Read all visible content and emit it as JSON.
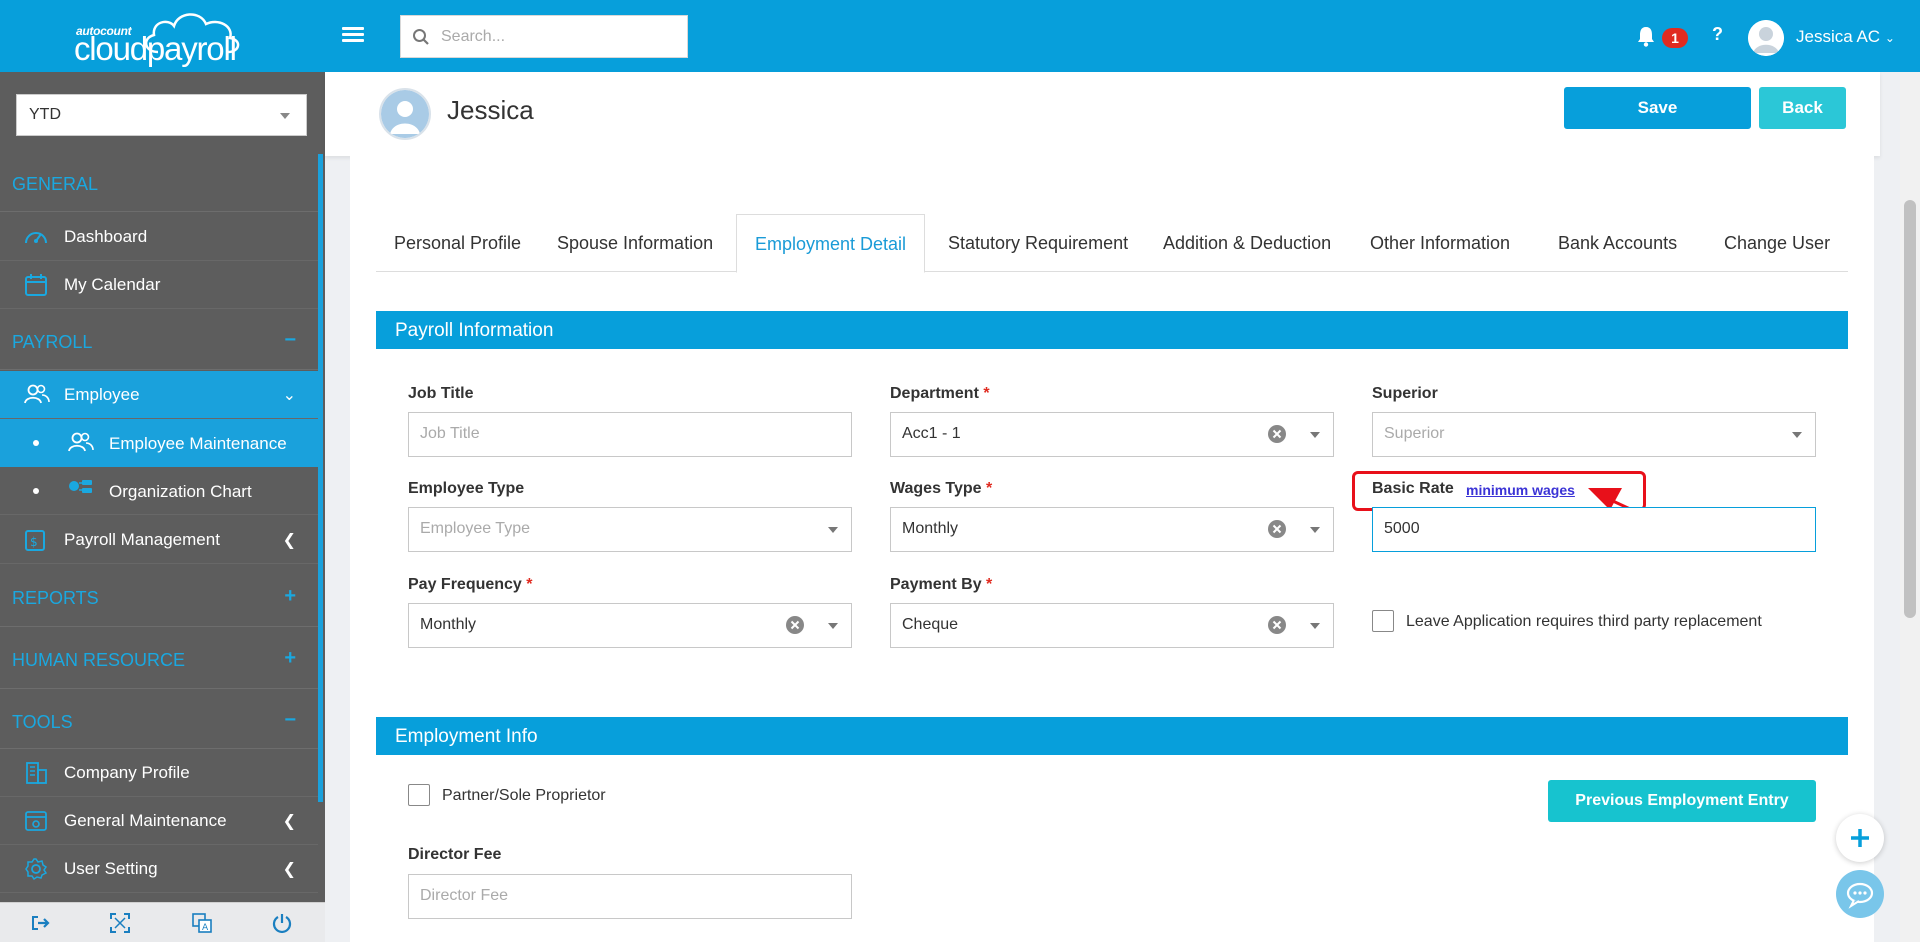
{
  "app": {
    "logo_small": "autocount",
    "logo_big": "cloudpayroll",
    "search_placeholder": "Search...",
    "notification_count": "1",
    "help": "?",
    "user": "Jessica AC"
  },
  "sidebar": {
    "period": "YTD",
    "sections": {
      "general": "GENERAL",
      "payroll": "PAYROLL",
      "reports": "REPORTS",
      "human_resource": "HUMAN RESOURCE",
      "tools": "TOOLS"
    },
    "signs": {
      "payroll": "−",
      "reports": "+",
      "human_resource": "+",
      "tools": "−"
    },
    "items": {
      "dashboard": "Dashboard",
      "my_calendar": "My Calendar",
      "employee": "Employee",
      "employee_maintenance": "Employee Maintenance",
      "organization_chart": "Organization Chart",
      "payroll_management": "Payroll Management",
      "company_profile": "Company Profile",
      "general_maintenance": "General Maintenance",
      "user_setting": "User Setting"
    }
  },
  "header": {
    "employee_name": "Jessica",
    "save": "Save",
    "back": "Back"
  },
  "tabs": [
    "Personal Profile",
    "Spouse Information",
    "Employment Detail",
    "Statutory Requirement",
    "Addition & Deduction",
    "Other Information",
    "Bank Accounts",
    "Change User"
  ],
  "payroll_info": {
    "title": "Payroll Information",
    "job_title": {
      "label": "Job Title",
      "placeholder": "Job Title"
    },
    "department": {
      "label": "Department",
      "value": "Acc1 - 1"
    },
    "superior": {
      "label": "Superior",
      "placeholder": "Superior"
    },
    "employee_type": {
      "label": "Employee Type",
      "placeholder": "Employee Type"
    },
    "wages_type": {
      "label": "Wages Type",
      "value": "Monthly"
    },
    "basic_rate": {
      "label": "Basic Rate",
      "link": "minimum wages",
      "value": "5000"
    },
    "pay_frequency": {
      "label": "Pay Frequency",
      "value": "Monthly"
    },
    "payment_by": {
      "label": "Payment By",
      "value": "Cheque"
    },
    "leave_replacement": "Leave Application requires third party replacement",
    "required_mark": "*"
  },
  "employment_info": {
    "title": "Employment Info",
    "partner": "Partner/Sole Proprietor",
    "previous_entry": "Previous Employment Entry",
    "director_fee": {
      "label": "Director Fee",
      "placeholder": "Director Fee"
    }
  },
  "colors": {
    "primary": "#079fdb",
    "accent": "#2bc7d7",
    "sidebar": "#5d5d5d",
    "highlight": "#e8101a"
  }
}
